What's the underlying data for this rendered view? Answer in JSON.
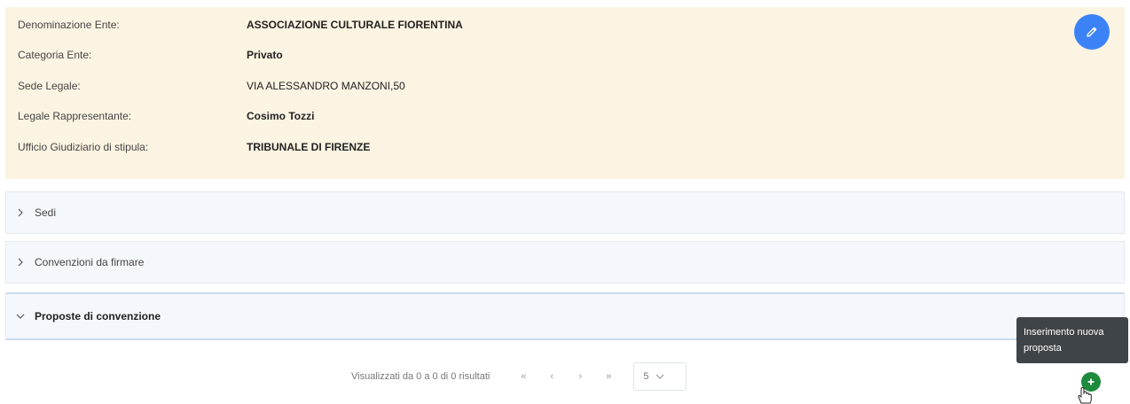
{
  "ente": {
    "rows": [
      {
        "label": "Denominazione Ente:",
        "value": "ASSOCIAZIONE CULTURALE FIORENTINA"
      },
      {
        "label": "Categoria Ente:",
        "value": "Privato"
      },
      {
        "label": "Sede Legale:",
        "value": "VIA ALESSANDRO MANZONI,50"
      },
      {
        "label": "Legale Rappresentante:",
        "value": "Cosimo Tozzi"
      },
      {
        "label": "Ufficio Giudiziario di stipula:",
        "value": "TRIBUNALE DI FIRENZE"
      }
    ],
    "edit_icon": "pencil-icon"
  },
  "accordion": [
    {
      "label": "Sedi",
      "expanded": false
    },
    {
      "label": "Convenzioni da firmare",
      "expanded": false
    },
    {
      "label": "Proposte di convenzione",
      "expanded": true
    }
  ],
  "pagination": {
    "summary": "Visualizzati da 0 a 0 di 0 risultati",
    "first": "«",
    "prev": "‹",
    "next": "›",
    "last": "»",
    "page_size": "5"
  },
  "add_button": {
    "tooltip": "Inserimento nuova proposta",
    "icon": "plus-icon"
  },
  "colors": {
    "card_bg": "#fcf4e2",
    "edit_button": "#3b82f6",
    "add_button": "#1e8a3c",
    "tooltip_bg": "#3f4449"
  }
}
